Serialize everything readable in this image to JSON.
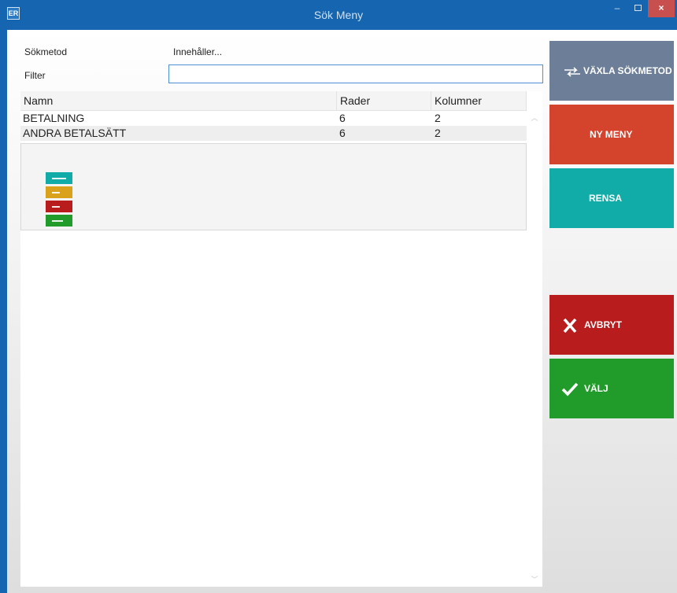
{
  "window": {
    "app_icon": "ER",
    "title": "Sök Meny",
    "minimize": "–",
    "close": "×"
  },
  "form": {
    "search_method_label": "Sökmetod",
    "search_method_value": "Innehåller...",
    "filter_label": "Filter",
    "filter_value": ""
  },
  "grid": {
    "columns": [
      "Namn",
      "Rader",
      "Kolumner"
    ],
    "rows": [
      {
        "name": "BETALNING",
        "rows": "6",
        "cols": "2"
      },
      {
        "name": "ANDRA BETALSÄTT",
        "rows": "6",
        "cols": "2"
      }
    ],
    "selected_row": 1
  },
  "preview": {
    "buttons": [
      {
        "color": "#11aca8",
        "icon": "long-line-icon"
      },
      {
        "color": "#d9a21a",
        "icon": "short-line-icon"
      },
      {
        "color": "#b91c1c",
        "icon": "short-line-icon"
      },
      {
        "color": "#219c2a",
        "icon": "medium-line-icon"
      }
    ]
  },
  "actions": {
    "switch": {
      "label": "VÄXLA SÖKMETOD",
      "icon": "swap-arrows-icon",
      "color": "#6d7f98"
    },
    "new_menu": {
      "label": "NY MENY",
      "color": "#d4442c"
    },
    "clear": {
      "label": "RENSA",
      "color": "#11aca8"
    },
    "cancel": {
      "label": "AVBRYT",
      "icon": "x-icon",
      "color": "#b91c1c"
    },
    "select": {
      "label": "VÄLJ",
      "icon": "checkmark-icon",
      "color": "#219c2a"
    }
  },
  "colors": {
    "titlebar": "#1565b0",
    "close_button": "#c7504f"
  }
}
